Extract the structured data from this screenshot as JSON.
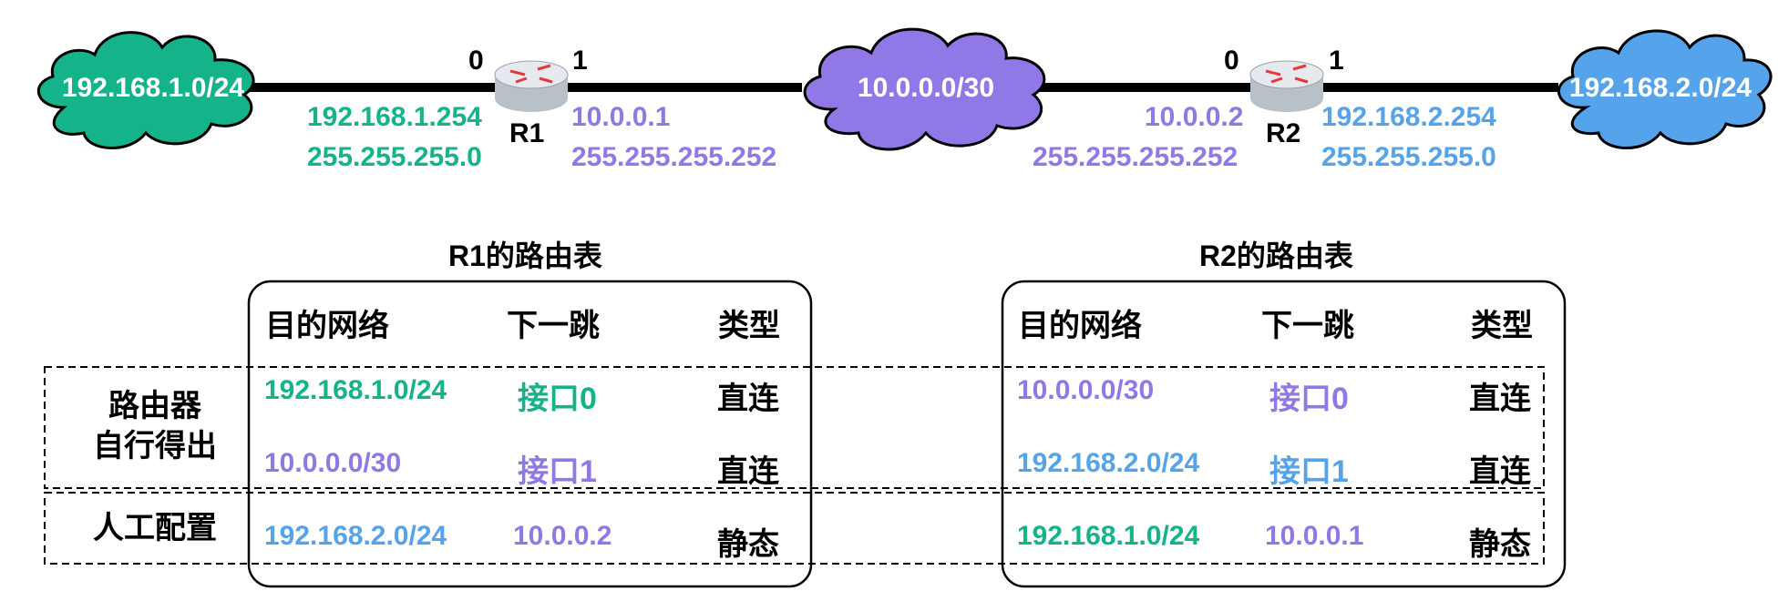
{
  "colors": {
    "green": "#14b38a",
    "purple": "#9079e6",
    "blue": "#55a3ea",
    "black": "#000000"
  },
  "network": {
    "clouds": [
      {
        "id": "net1",
        "label": "192.168.1.0/24",
        "color": "#14b38a"
      },
      {
        "id": "net2",
        "label": "10.0.0.0/30",
        "color": "#9079e6"
      },
      {
        "id": "net3",
        "label": "192.168.2.0/24",
        "color": "#55a3ea"
      }
    ],
    "r1": {
      "name": "R1",
      "port0": "0",
      "port1": "1",
      "if0_ip": "192.168.1.254",
      "if0_mask": "255.255.255.0",
      "if1_ip": "10.0.0.1",
      "if1_mask": "255.255.255.252"
    },
    "r2": {
      "name": "R2",
      "port0": "0",
      "port1": "1",
      "if0_ip": "10.0.0.2",
      "if0_mask": "255.255.255.252",
      "if1_ip": "192.168.2.254",
      "if1_mask": "255.255.255.0"
    }
  },
  "tables": {
    "r1": {
      "title": "R1的路由表",
      "headers": [
        "目的网络",
        "下一跳",
        "类型"
      ],
      "rows": [
        {
          "dest": "192.168.1.0/24",
          "next": "接口0",
          "type": "直连"
        },
        {
          "dest": "10.0.0.0/30",
          "next": "接口1",
          "type": "直连"
        },
        {
          "dest": "192.168.2.0/24",
          "next": "10.0.0.2",
          "type": "静态"
        }
      ]
    },
    "r2": {
      "title": "R2的路由表",
      "headers": [
        "目的网络",
        "下一跳",
        "类型"
      ],
      "rows": [
        {
          "dest": "10.0.0.0/30",
          "next": "接口0",
          "type": "直连"
        },
        {
          "dest": "192.168.2.0/24",
          "next": "接口1",
          "type": "直连"
        },
        {
          "dest": "192.168.1.0/24",
          "next": "10.0.0.1",
          "type": "静态"
        }
      ]
    }
  },
  "groups": {
    "auto": "路由器自行得出",
    "auto_line1": "路由器",
    "auto_line2": "自行得出",
    "manual": "人工配置"
  }
}
